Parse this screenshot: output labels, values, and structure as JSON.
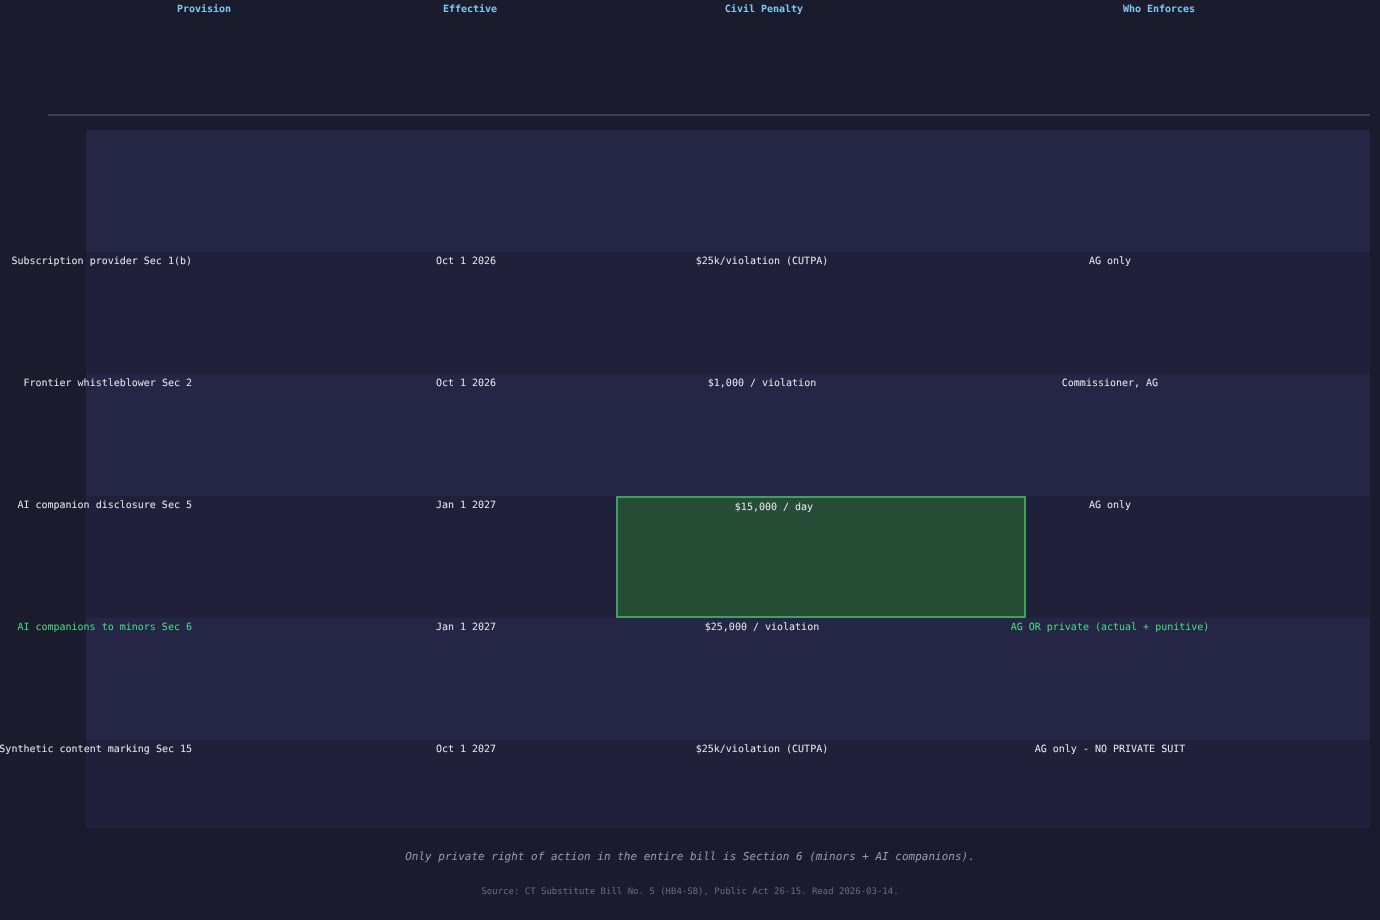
{
  "columns": [
    "Provision",
    "Effective",
    "Civil Penalty",
    "Who Enforces"
  ],
  "rows": [
    {
      "provision": "Subscription provider Sec 1(b)",
      "effective": "Oct 1 2026",
      "penalty": "$25k/violation (CUTPA)",
      "enforcer": "AG only",
      "highlighted": false,
      "penalty_highlighted": false
    },
    {
      "provision": "Frontier whistleblower Sec 2",
      "effective": "Oct 1 2026",
      "penalty": "$1,000 / violation",
      "enforcer": "Commissioner, AG",
      "highlighted": false,
      "penalty_highlighted": false
    },
    {
      "provision": "AI companion disclosure Sec 5",
      "effective": "Jan 1 2027",
      "penalty": "$15,000 / day",
      "enforcer": "AG only",
      "highlighted": false,
      "penalty_highlighted": true
    },
    {
      "provision": "AI companions to minors Sec 6",
      "effective": "Jan 1 2027",
      "penalty": "$25,000 / violation",
      "enforcer": "AG OR private (actual + punitive)",
      "highlighted": true,
      "penalty_highlighted": false
    },
    {
      "provision": "Synthetic content marking Sec 15",
      "effective": "Oct 1 2027",
      "penalty": "$25k/violation (CUTPA)",
      "enforcer": "AG only - NO PRIVATE SUIT",
      "highlighted": false,
      "penalty_highlighted": false
    }
  ],
  "note": "Only private right of action in the entire bill is Section 6 (minors + AI companions).",
  "source": "Source: CT Substitute Bill No. 5 (HB4-SB), Public Act 26-15. Read 2026-03-14."
}
